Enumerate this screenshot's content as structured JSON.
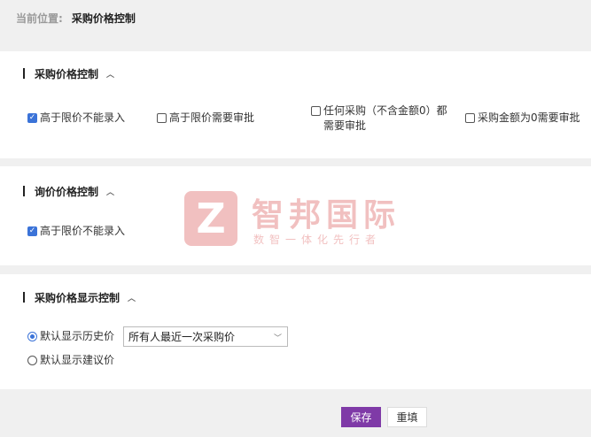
{
  "breadcrumb": {
    "label": "当前位置:",
    "current": "采购价格控制"
  },
  "purchase_price_control": {
    "title": "采购价格控制",
    "options": [
      {
        "label": "高于限价不能录入",
        "checked": true
      },
      {
        "label": "高于限价需要审批",
        "checked": false
      },
      {
        "label": "任何采购（不含金额0）都需要审批",
        "checked": false
      },
      {
        "label": "采购金额为0需要审批",
        "checked": false
      }
    ]
  },
  "inquiry_price_control": {
    "title": "询价价格控制",
    "options": [
      {
        "label": "高于限价不能录入",
        "checked": true
      }
    ]
  },
  "display_control": {
    "title": "采购价格显示控制",
    "radio_history": {
      "label": "默认显示历史价",
      "selected": true
    },
    "history_select": {
      "value": "所有人最近一次采购价"
    },
    "radio_suggest": {
      "label": "默认显示建议价",
      "selected": false
    }
  },
  "footer": {
    "save_label": "保存",
    "reset_label": "重填"
  },
  "watermark": {
    "logo": "Z",
    "name": "智邦国际",
    "tagline": "数智一体化先行者"
  },
  "colors": {
    "accent": "#3b73d8",
    "primary_button": "#7f3aa7",
    "watermark": "#e06a6a"
  }
}
